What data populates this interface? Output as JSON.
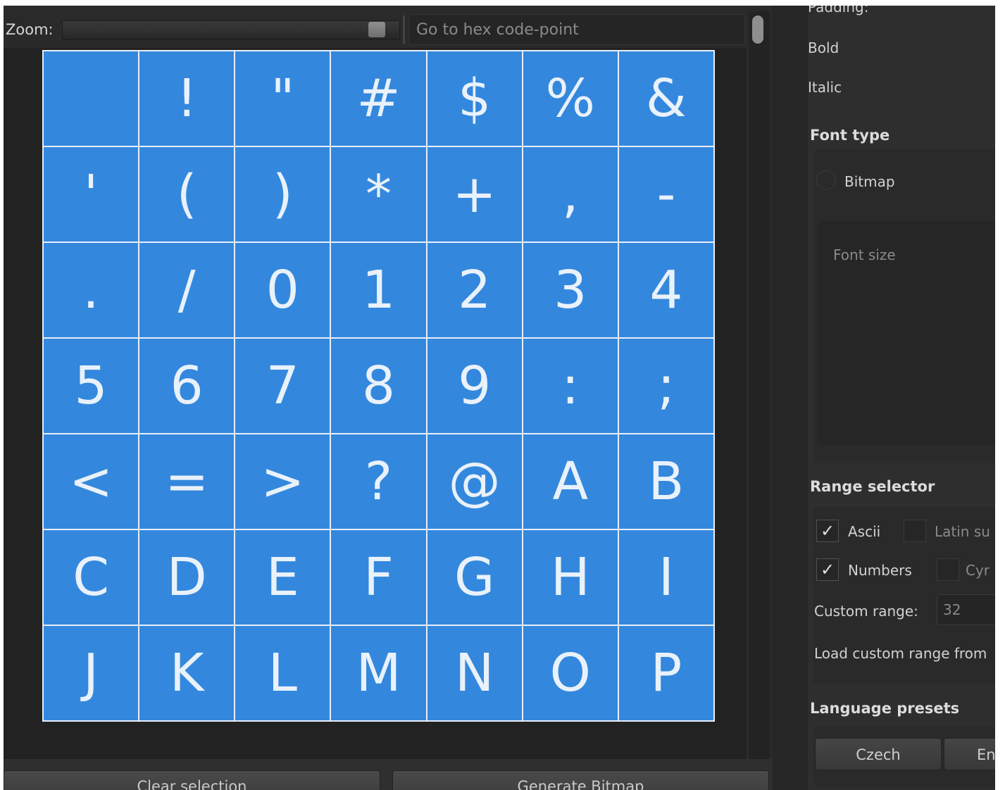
{
  "toolbar": {
    "zoom_label": "Zoom:",
    "zoom_level": 0.96,
    "hex_placeholder": "Go to hex code-point"
  },
  "glyph_grid": {
    "rows": [
      [
        " ",
        "!",
        "\"",
        "#",
        "$",
        "%",
        "&"
      ],
      [
        "'",
        "(",
        ")",
        "*",
        "+",
        ",",
        "-"
      ],
      [
        ".",
        "/",
        "0",
        "1",
        "2",
        "3",
        "4"
      ],
      [
        "5",
        "6",
        "7",
        "8",
        "9",
        ":",
        ";"
      ],
      [
        "<",
        "=",
        ">",
        "?",
        "@",
        "A",
        "B"
      ],
      [
        "C",
        "D",
        "E",
        "F",
        "G",
        "H",
        "I"
      ],
      [
        "J",
        "K",
        "L",
        "M",
        "N",
        "O",
        "P"
      ]
    ],
    "selected_color": "#3388dd"
  },
  "bottom_buttons": {
    "clear_label": "Clear selection",
    "generate_label": "Generate Bitmap"
  },
  "properties": {
    "padding_label": "Padding:",
    "bold_label": "Bold",
    "italic_label": "Italic",
    "font_type_heading": "Font type",
    "bitmap_label": "Bitmap",
    "font_size_label": "Font size",
    "range_selector_heading": "Range selector",
    "ascii_label": "Ascii",
    "ascii_checked": true,
    "latin_label": "Latin su",
    "latin_checked": false,
    "numbers_label": "Numbers",
    "numbers_checked": true,
    "cyrillic_label": "Cyr",
    "cyrillic_checked": false,
    "custom_range_label": "Custom range:",
    "custom_range_value": "32",
    "load_custom_range_label": "Load custom range from",
    "language_presets_heading": "Language presets",
    "preset_czech": "Czech",
    "preset_en": "En"
  },
  "icons": {
    "checkmark": "check-icon"
  }
}
